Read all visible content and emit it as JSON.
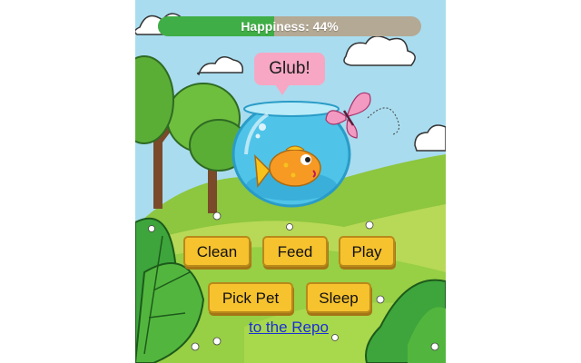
{
  "happiness": {
    "label": "Happiness: 44%",
    "value_percent": 44,
    "fill_color": "#3fae46",
    "track_color": "#b4a994"
  },
  "pet": {
    "speech": "Glub!",
    "type": "goldfish"
  },
  "actions": {
    "clean": "Clean",
    "feed": "Feed",
    "play": "Play",
    "pick_pet": "Pick Pet",
    "sleep": "Sleep"
  },
  "footer": {
    "repo_link": "to the Repo"
  },
  "colors": {
    "button": "#f6c22e",
    "link": "#1a2fd6",
    "speech_bubble": "#f7a7c3",
    "sky": "#a9dcef",
    "grass": "#8dc63f"
  },
  "icons": [
    "fishbowl-icon",
    "goldfish-icon",
    "butterfly-icon",
    "cloud-icon",
    "tree-icon",
    "flower-icon"
  ]
}
